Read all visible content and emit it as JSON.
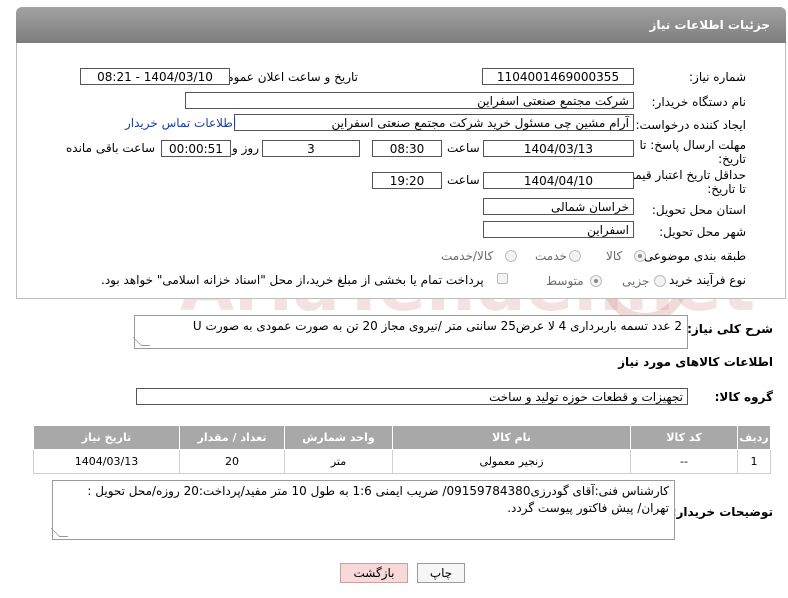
{
  "header": {
    "title": "جزئیات اطلاعات نیاز"
  },
  "fields": {
    "need_number": {
      "label": "شماره نیاز:",
      "value": "1104001469000355"
    },
    "announce": {
      "label": "تاریخ و ساعت اعلان عمومی:",
      "value": "1404/03/10 - 08:21"
    },
    "buyer_org": {
      "label": "نام دستگاه خریدار:",
      "value": "شرکت مجتمع صنعتی اسفراین"
    },
    "requester": {
      "label": "ایجاد کننده درخواست:",
      "value": "آرام مشین چی مسئول خرید شرکت مجتمع صنعتی اسفراین",
      "contact_link": "اطلاعات تماس خریدار"
    },
    "deadline": {
      "label_line1": "مهلت ارسال پاسخ: تا",
      "label_line2": "تاریخ:",
      "date": "1404/03/13",
      "time_label": "ساعت",
      "time": "08:30",
      "days": "3",
      "days_label": "روز و",
      "remaining": "00:00:51",
      "remaining_label": "ساعت باقی مانده"
    },
    "validity": {
      "label_line1": "حداقل تاریخ اعتبار قیمت:",
      "label_line2": "تا تاریخ:",
      "date": "1404/04/10",
      "time_label": "ساعت",
      "time": "19:20"
    },
    "province": {
      "label": "استان محل تحویل:",
      "value": "خراسان شمالی"
    },
    "city": {
      "label": "شهر محل تحویل:",
      "value": "اسفراین"
    },
    "category": {
      "label": "طبقه بندی موضوعی:",
      "options": [
        "کالا",
        "خدمت",
        "کالا/خدمت"
      ],
      "selected": "کالا"
    },
    "purchase_type": {
      "label": "نوع فرآیند خرید :",
      "options": [
        "جزیی",
        "متوسط"
      ],
      "selected": "متوسط",
      "payment_note": "پرداخت تمام یا بخشی از مبلغ خرید،از محل \"اسناد خزانه اسلامی\" خواهد بود."
    }
  },
  "description": {
    "label": "شرح کلی نیاز:",
    "text": "2 عدد  تسمه باربرداری 4 لا عرض25 سانتی متر /نیروی مجاز 20 تن به صورت عمودی به صورت U"
  },
  "goods_info": {
    "title": "اطلاعات کالاهای مورد نیاز",
    "group_label": "گروه کالا:",
    "group_value": "تجهیزات و قطعات حوزه تولید و ساخت"
  },
  "table": {
    "headers": [
      "ردیف",
      "کد کالا",
      "نام کالا",
      "واحد شمارش",
      "تعداد / مقدار",
      "تاریخ نیاز"
    ],
    "rows": [
      [
        "1",
        "--",
        "زنجیر معمولی",
        "متر",
        "20",
        "1404/03/13"
      ]
    ]
  },
  "buyer_notes": {
    "label": "توضیحات خریدار:",
    "text": "کارشناس فنی:آقای گودرزی09159784380/ ضریب ایمنی 1:6 به طول 10 متر مفید/پرداخت:20 روزه/محل تحویل : تهران/ پیش فاکتور پیوست گردد."
  },
  "buttons": {
    "print": "چاپ",
    "back": "بازگشت"
  },
  "watermark": {
    "text": "AriaTender.net"
  },
  "colors": {
    "header_bg": "#8c8c8c",
    "link": "#1a3fa8",
    "back_button": "#f7d9d9",
    "watermark": "#e8b3b3"
  }
}
